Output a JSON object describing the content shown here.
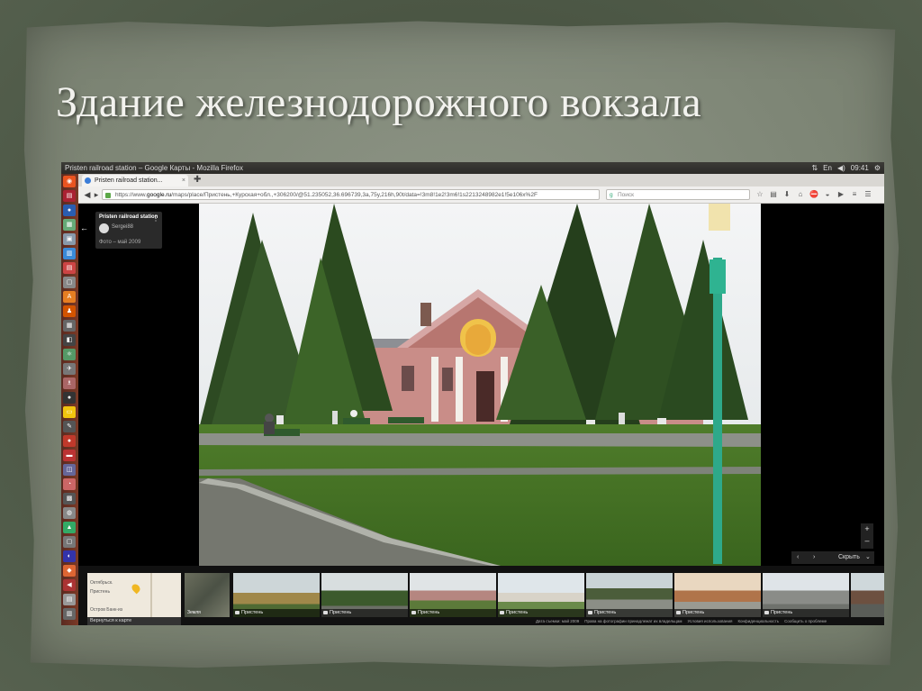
{
  "slide": {
    "title": "Здание железнодорожного вокзала"
  },
  "os": {
    "window_title": "Pristen railroad station – Google Карты - Mozilla Firefox",
    "time": "09:41"
  },
  "browser": {
    "tab_title": "Pristen railroad station...",
    "url_prefix": "https://www.",
    "url_host": "google.ru",
    "url_path": "/maps/place/Пристень,+Курская+обл.,+306200/@51.235052,36.696739,3a,75y,216h,90t/data=!3m8!1e2!3m6!1s2213248982e1!5e106x%2F",
    "search_placeholder": "Поиск"
  },
  "place_card": {
    "name": "Pristen railroad station",
    "author": "Sergei88",
    "date": "Фото – май 2009"
  },
  "controls": {
    "hide_label": "Скрыть"
  },
  "filmstrip": {
    "map_caption": "Вернуться к карте",
    "map_labels": [
      "Октябрьск.",
      "Пристень",
      "Остров Банк-из"
    ],
    "satellite_label": "Земля",
    "thumbs": [
      {
        "caption": "Пристень"
      },
      {
        "caption": "Пристень"
      },
      {
        "caption": "Пристень"
      },
      {
        "caption": "Пристень"
      },
      {
        "caption": "Пристень"
      },
      {
        "caption": "Пристень"
      },
      {
        "caption": "Пристень"
      }
    ],
    "footer_links": [
      "Дата съемки: май 2009",
      "Права на фотографии принадлежат их владельцам",
      "Условия использования",
      "Конфиденциальность",
      "Сообщить о проблеме"
    ]
  },
  "colors": {
    "launcher": "#7b3a26",
    "slide_background": "#4f5a48",
    "parchment": "#7e8676"
  }
}
